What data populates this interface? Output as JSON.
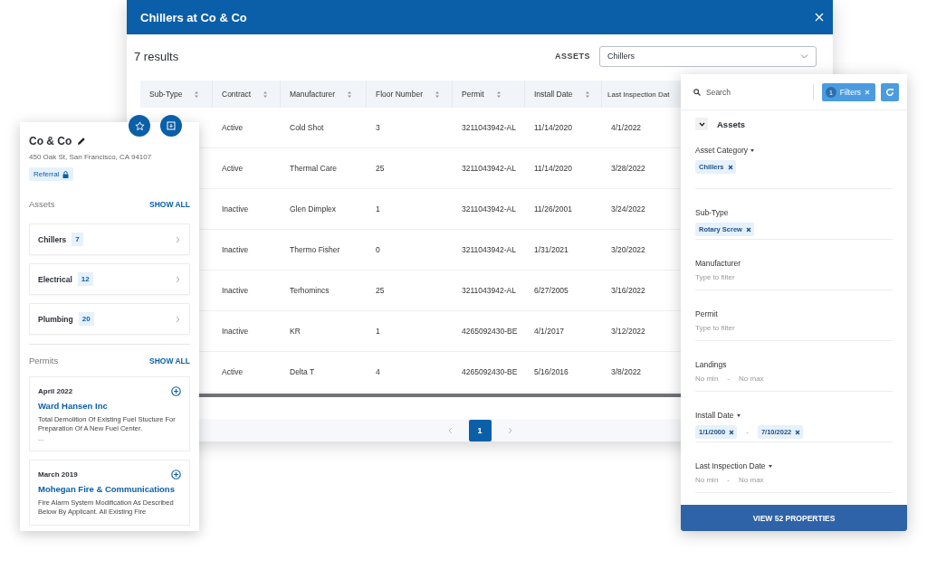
{
  "modal": {
    "title": "Chillers at Co & Co",
    "results": "7 results",
    "assets_filter": {
      "label": "ASSETS",
      "value": "Chillers"
    },
    "table": {
      "columns": [
        "Sub-Type",
        "Contract",
        "Manufacturer",
        "Floor Number",
        "Permit",
        "Install Date",
        "Last Inspection Dat"
      ],
      "rows": [
        {
          "cells": [
            "",
            "Active",
            "Cold Shot",
            "3",
            "3211043942-AL",
            "11/14/2020",
            "4/1/2022"
          ]
        },
        {
          "cells": [
            "",
            "Active",
            "Thermal Care",
            "25",
            "3211043942-AL",
            "11/14/2020",
            "3/28/2022"
          ]
        },
        {
          "cells": [
            "",
            "Inactive",
            "Glen Dimplex",
            "1",
            "3211043942-AL",
            "11/26/2001",
            "3/24/2022"
          ]
        },
        {
          "cells": [
            "",
            "Inactive",
            "Thermo Fisher",
            "0",
            "3211043942-AL",
            "1/31/2021",
            "3/20/2022"
          ]
        },
        {
          "cells": [
            "",
            "Inactive",
            "Terhomincs",
            "25",
            "3211043942-AL",
            "6/27/2005",
            "3/16/2022"
          ]
        },
        {
          "cells": [
            "",
            "Inactive",
            "KR",
            "1",
            "4265092430-BE",
            "4/1/2017",
            "3/12/2022"
          ]
        },
        {
          "cells": [
            "",
            "Active",
            "Delta T",
            "4",
            "4265092430-BE",
            "5/16/2016",
            "3/8/2022"
          ]
        }
      ]
    },
    "pagination": [
      {
        "label": "1",
        "selected": true
      }
    ]
  },
  "property_card": {
    "name": "Co & Co",
    "address": "450 Oak St, San Francisco, CA 94107",
    "tag": "Referral",
    "assets": {
      "title": "Assets",
      "show_all": "SHOW ALL",
      "items": [
        {
          "label": "Chillers",
          "count": "7"
        },
        {
          "label": "Electrical",
          "count": "12"
        },
        {
          "label": "Plumbing",
          "count": "20"
        }
      ]
    },
    "permits": {
      "title": "Permits",
      "show_all": "SHOW ALL",
      "items": [
        {
          "date": "April 2022",
          "company": "Ward Hansen Inc",
          "description": "Total Demolition Of Existing Fuel Stucture For Preparation Of A New Fuel Center.",
          "more": "..."
        },
        {
          "date": "March 2019",
          "company": "Mohegan Fire & Communications",
          "description": "Fire Alarm System Modification As Described Below By Applicant. All Existing Fire"
        }
      ]
    }
  },
  "filter_panel": {
    "search": {
      "placeholder": "Search"
    },
    "filters_chip": {
      "count": "1",
      "label": "Filters"
    },
    "section": {
      "title": "Assets",
      "expanded": true
    },
    "fields": [
      {
        "kind": "chips",
        "label": "Asset Category",
        "dropdown": true,
        "chips": [
          "Chillers"
        ]
      },
      {
        "kind": "chips",
        "label": "Sub-Type",
        "dropdown": false,
        "chips": [
          "Rotary Screw"
        ]
      },
      {
        "kind": "text",
        "label": "Manufacturer",
        "placeholder": "Type to filter"
      },
      {
        "kind": "text",
        "label": "Permit",
        "placeholder": "Type to filter"
      },
      {
        "kind": "range",
        "label": "Landings",
        "dropdown": false,
        "min": "No min",
        "separator": "-",
        "max": "No max"
      },
      {
        "kind": "chip_range",
        "label": "Install Date",
        "dropdown": true,
        "min": "1/1/2000",
        "separator": "-",
        "max": "7/10/2022"
      },
      {
        "kind": "range",
        "label": "Last Inspection Date",
        "dropdown": true,
        "min": "No min",
        "separator": "-",
        "max": "No max"
      }
    ],
    "view_button": "VIEW 52 PROPERTIES"
  }
}
